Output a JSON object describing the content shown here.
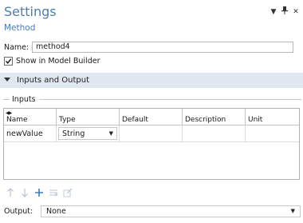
{
  "header": {
    "title": "Settings",
    "subtitle": "Method",
    "controls": [
      "chevron-down-icon",
      "pin-icon",
      "close-icon"
    ]
  },
  "name_field": {
    "label": "Name:",
    "value": "method4"
  },
  "show_in_model_builder": {
    "label": "Show in Model Builder",
    "checked": true
  },
  "section": {
    "title": "Inputs and Output",
    "expanded": true
  },
  "inputs_group": {
    "label": "Inputs"
  },
  "table": {
    "sort_glyph": "◀▶",
    "columns": [
      "Name",
      "Type",
      "Default",
      "Description",
      "Unit"
    ],
    "rows": [
      {
        "name": "newValue",
        "type": "String",
        "default": "",
        "description": "",
        "unit": ""
      }
    ]
  },
  "toolbar": {
    "buttons": [
      "move-up-icon",
      "move-down-icon",
      "add-icon",
      "delete-icon",
      "edit-icon"
    ]
  },
  "output": {
    "label": "Output:",
    "value": "None"
  },
  "colors": {
    "title": "#4a7db3",
    "section_bg": "#dfe8f1",
    "add_icon": "#3a7fc9"
  }
}
